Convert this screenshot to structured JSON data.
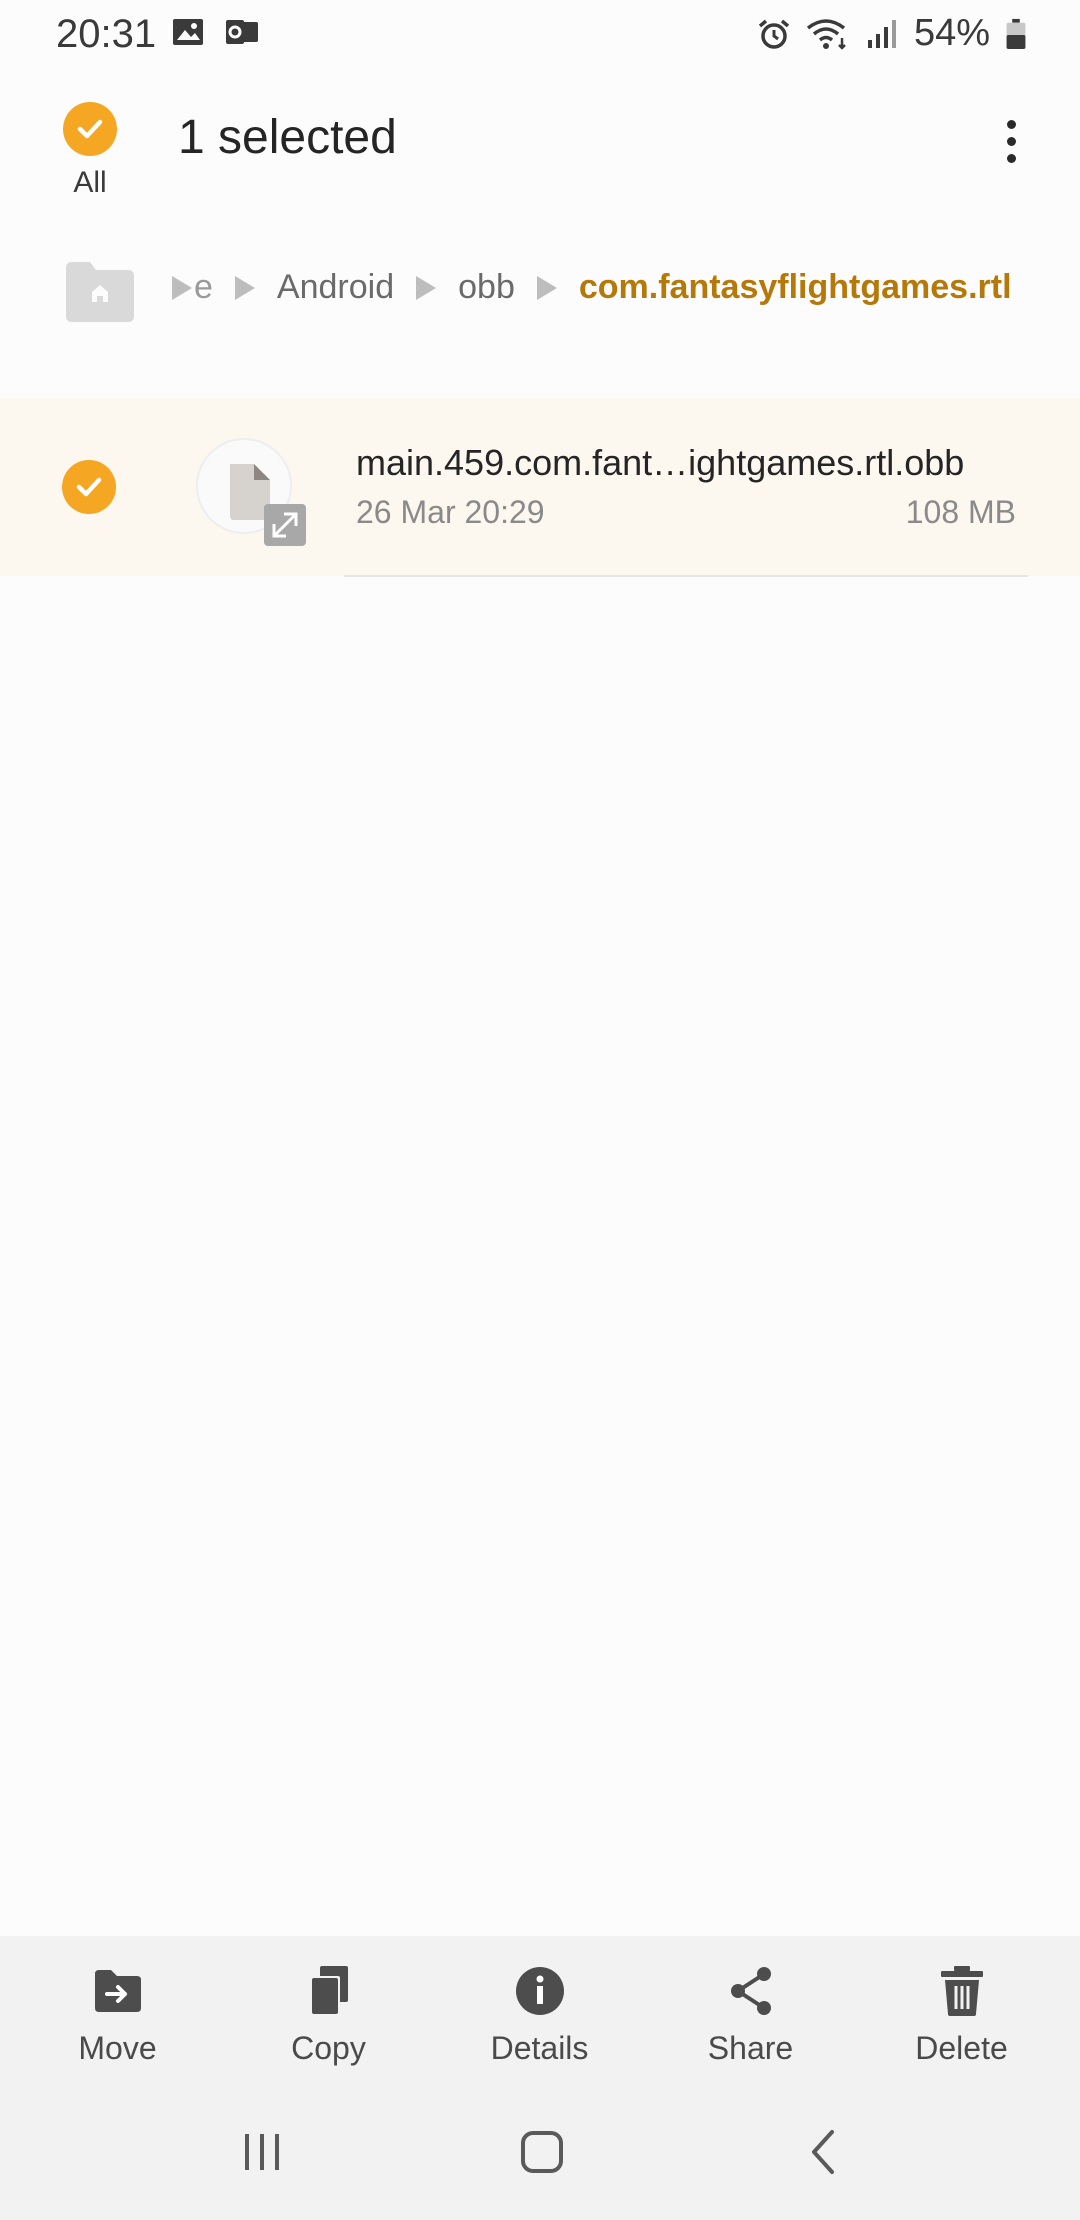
{
  "status_bar": {
    "time": "20:31",
    "battery": "54%",
    "left_icons": [
      "image-icon",
      "outlook-icon"
    ],
    "right_icons": [
      "alarm-icon",
      "wifi-icon",
      "signal-icon",
      "battery-icon"
    ]
  },
  "header": {
    "select_all_label": "All",
    "title": "1 selected",
    "accent_color": "#f5a623"
  },
  "breadcrumb": {
    "partial": "e",
    "items": [
      "Android",
      "obb"
    ],
    "current": "com.fantasyflightgames.rtl",
    "current_color": "#b5790a"
  },
  "files": [
    {
      "name": "main.459.com.fant…ightgames.rtl.obb",
      "date": "26 Mar 20:29",
      "size": "108 MB",
      "selected": true
    }
  ],
  "actions": [
    {
      "label": "Move",
      "icon": "move-icon"
    },
    {
      "label": "Copy",
      "icon": "copy-icon"
    },
    {
      "label": "Details",
      "icon": "info-icon"
    },
    {
      "label": "Share",
      "icon": "share-icon"
    },
    {
      "label": "Delete",
      "icon": "trash-icon"
    }
  ],
  "nav": [
    "recent-apps-icon",
    "home-icon",
    "back-icon"
  ]
}
